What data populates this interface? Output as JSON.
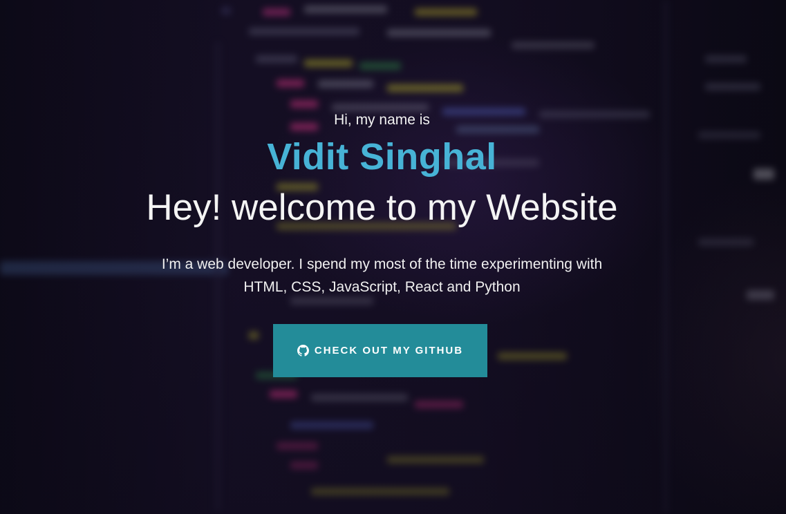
{
  "hero": {
    "greeting": "Hi, my name is",
    "name": "Vidit Singhal",
    "welcome": "Hey! welcome to my Website",
    "bio": "I’m a web developer. I spend my most of the time experimenting with HTML, CSS, JavaScript, React and Python"
  },
  "cta": {
    "label": "CHECK OUT MY GITHUB",
    "icon": "github-icon"
  },
  "colors": {
    "accent_name": "#47b3d6",
    "button_bg": "#238c99",
    "background": "#0f0b1c"
  }
}
